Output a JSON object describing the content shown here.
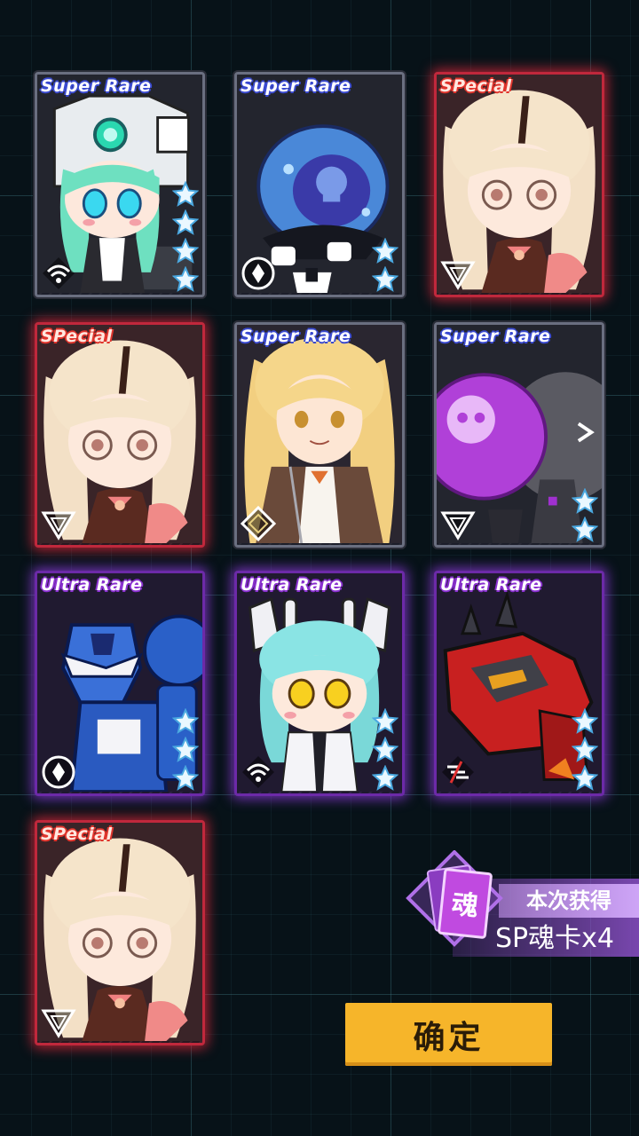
{
  "cards": [
    {
      "rarity_label": "Super Rare",
      "tier": "sr",
      "stars": 4,
      "element_icon": "wifi-element-icon",
      "character": "white-mech-helmet-girl"
    },
    {
      "rarity_label": "Super Rare",
      "tier": "sr",
      "stars": 2,
      "element_icon": "water-drop-element-icon",
      "character": "blue-skull-capsule-bot"
    },
    {
      "rarity_label": "SPecial",
      "tier": "sp",
      "stars": 0,
      "element_icon": "triangle-element-icon",
      "character": "glasses-twin-tail-girl"
    },
    {
      "rarity_label": "SPecial",
      "tier": "sp",
      "stars": 0,
      "element_icon": "triangle-element-icon",
      "character": "glasses-twin-tail-girl"
    },
    {
      "rarity_label": "Super Rare",
      "tier": "sr",
      "stars": 0,
      "element_icon": "diamond-element-icon",
      "character": "blonde-long-hair-girl"
    },
    {
      "rarity_label": "Super Rare",
      "tier": "sr",
      "stars": 2,
      "element_icon": "triangle-element-icon",
      "character": "purple-skull-ball-bot"
    },
    {
      "rarity_label": "Ultra Rare",
      "tier": "ur",
      "stars": 3,
      "element_icon": "water-drop-element-icon",
      "character": "blue-armored-mech"
    },
    {
      "rarity_label": "Ultra Rare",
      "tier": "ur",
      "stars": 3,
      "element_icon": "wifi-element-icon",
      "character": "cyan-hair-antenna-girl"
    },
    {
      "rarity_label": "Ultra Rare",
      "tier": "ur",
      "stars": 3,
      "element_icon": "slash-element-icon",
      "character": "red-dragon-mech"
    },
    {
      "rarity_label": "SPecial",
      "tier": "sp",
      "stars": 0,
      "element_icon": "triangle-element-icon",
      "character": "glasses-twin-tail-girl"
    }
  ],
  "reward": {
    "title": "本次获得",
    "text": "SP魂卡x4",
    "icon_glyph": "魂"
  },
  "confirm_label": "确定",
  "colors": {
    "accent": "#f6b52a",
    "special": "#c0283c",
    "ultra": "#6c2aa8",
    "super": "#6a6f80"
  }
}
